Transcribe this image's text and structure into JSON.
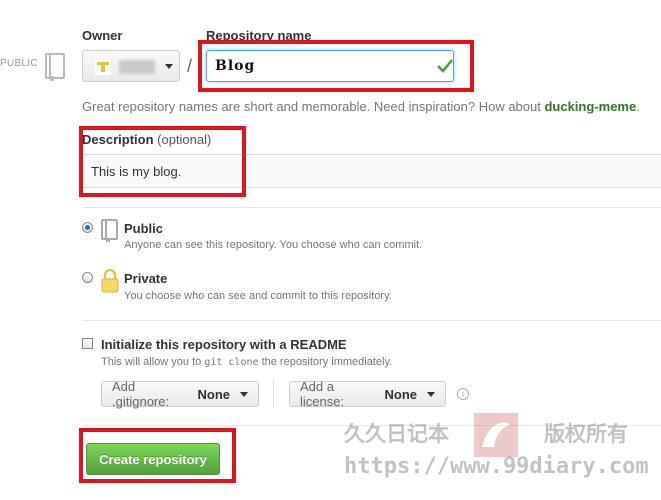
{
  "side": {
    "public_label": "PUBLIC"
  },
  "owner": {
    "label": "Owner"
  },
  "repo": {
    "label": "Repository name",
    "value": "Blog",
    "slash": "/"
  },
  "hint": {
    "text": "Great repository names are short and memorable. Need inspiration? How about ",
    "suggestion": "ducking-meme",
    "end": "."
  },
  "description": {
    "label": "Description",
    "optional": "(optional)",
    "value": "This is my blog."
  },
  "visibility": {
    "public": {
      "title": "Public",
      "note": "Anyone can see this repository. You choose who can commit.",
      "selected": true
    },
    "private": {
      "title": "Private",
      "note": "You choose who can see and commit to this repository.",
      "selected": false
    }
  },
  "readme": {
    "title": "Initialize this repository with a README",
    "note_before": "This will allow you to ",
    "note_code": "git clone",
    "note_after": " the repository immediately.",
    "checked": false
  },
  "gitignore": {
    "label": "Add .gitignore:",
    "value": "None"
  },
  "license": {
    "label": "Add a license:",
    "value": "None"
  },
  "create_button": "Create repository",
  "watermark": {
    "left": "久久日记本",
    "right": "版权所有",
    "url": "https://www.99diary.com"
  },
  "colors": {
    "highlight": "#e0141e",
    "create_button": "#60b044",
    "focus_border": "#51a7e8"
  }
}
